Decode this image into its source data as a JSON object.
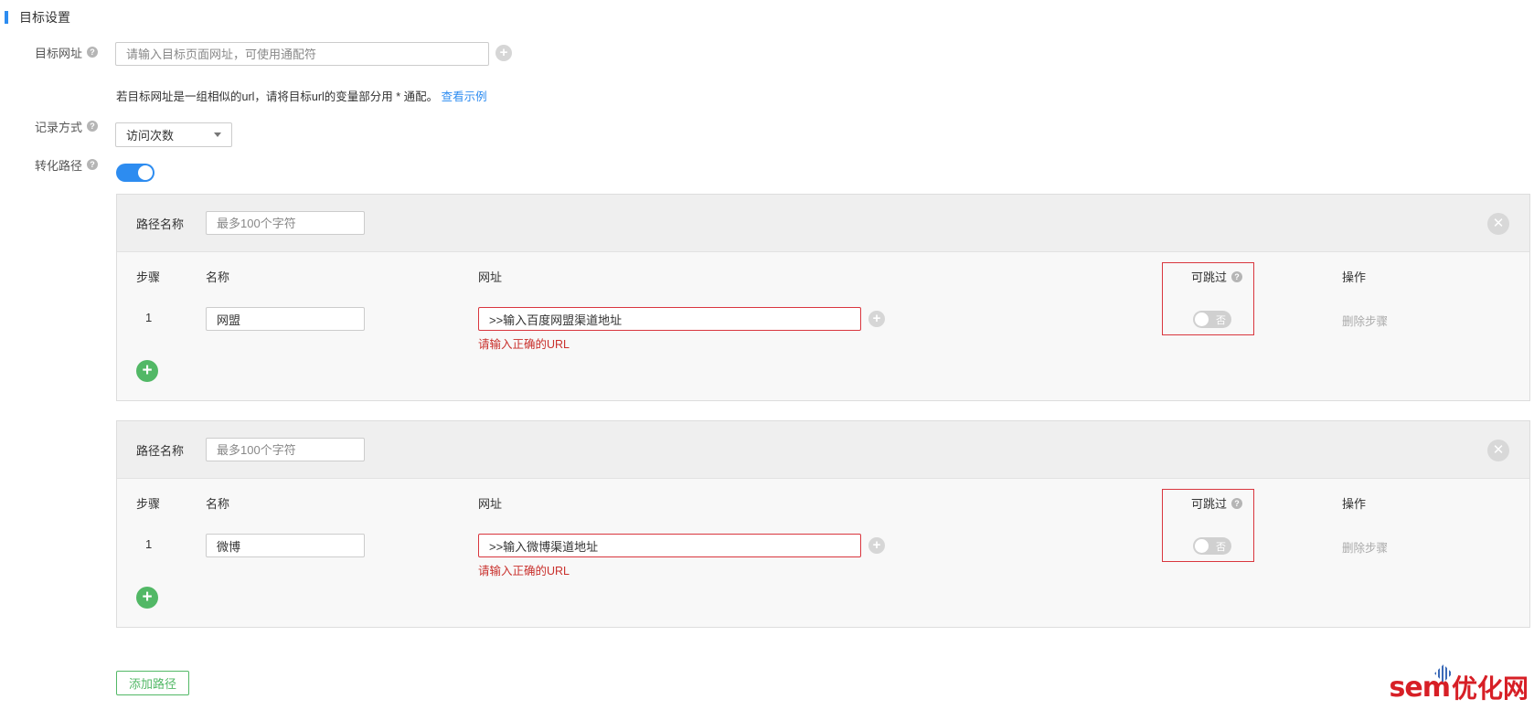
{
  "section": {
    "title": "目标设置"
  },
  "target_url": {
    "label": "目标网址",
    "placeholder": "请输入目标页面网址，可使用通配符",
    "hint": "若目标网址是一组相似的url，请将目标url的变量部分用 * 通配。",
    "hint_link": "查看示例"
  },
  "record_method": {
    "label": "记录方式",
    "value": "访问次数"
  },
  "conversion_path": {
    "label": "转化路径",
    "enabled": true
  },
  "paths": [
    {
      "name_label": "路径名称",
      "name_placeholder": "最多100个字符",
      "headers": {
        "step": "步骤",
        "name": "名称",
        "url": "网址",
        "skippable": "可跳过",
        "action": "操作"
      },
      "steps": [
        {
          "index": "1",
          "name": "网盟",
          "url": ">>输入百度网盟渠道地址",
          "error": "请输入正确的URL",
          "skip": "否",
          "action": "删除步骤"
        }
      ]
    },
    {
      "name_label": "路径名称",
      "name_placeholder": "最多100个字符",
      "headers": {
        "step": "步骤",
        "name": "名称",
        "url": "网址",
        "skippable": "可跳过",
        "action": "操作"
      },
      "steps": [
        {
          "index": "1",
          "name": "微博",
          "url": ">>输入微博渠道地址",
          "error": "请输入正确的URL",
          "skip": "否",
          "action": "删除步骤"
        }
      ]
    }
  ],
  "add_path_button": "添加路径",
  "watermark": {
    "brand": "sem",
    "suffix": "优化网"
  },
  "icons": {
    "help": "help-icon",
    "plus": "plus-icon",
    "close": "close-icon",
    "add_step": "add-step-icon",
    "dropdown": "chevron-down-icon"
  },
  "colors": {
    "accent": "#2d8cf0",
    "error": "#d9363e",
    "success": "#52b866"
  }
}
